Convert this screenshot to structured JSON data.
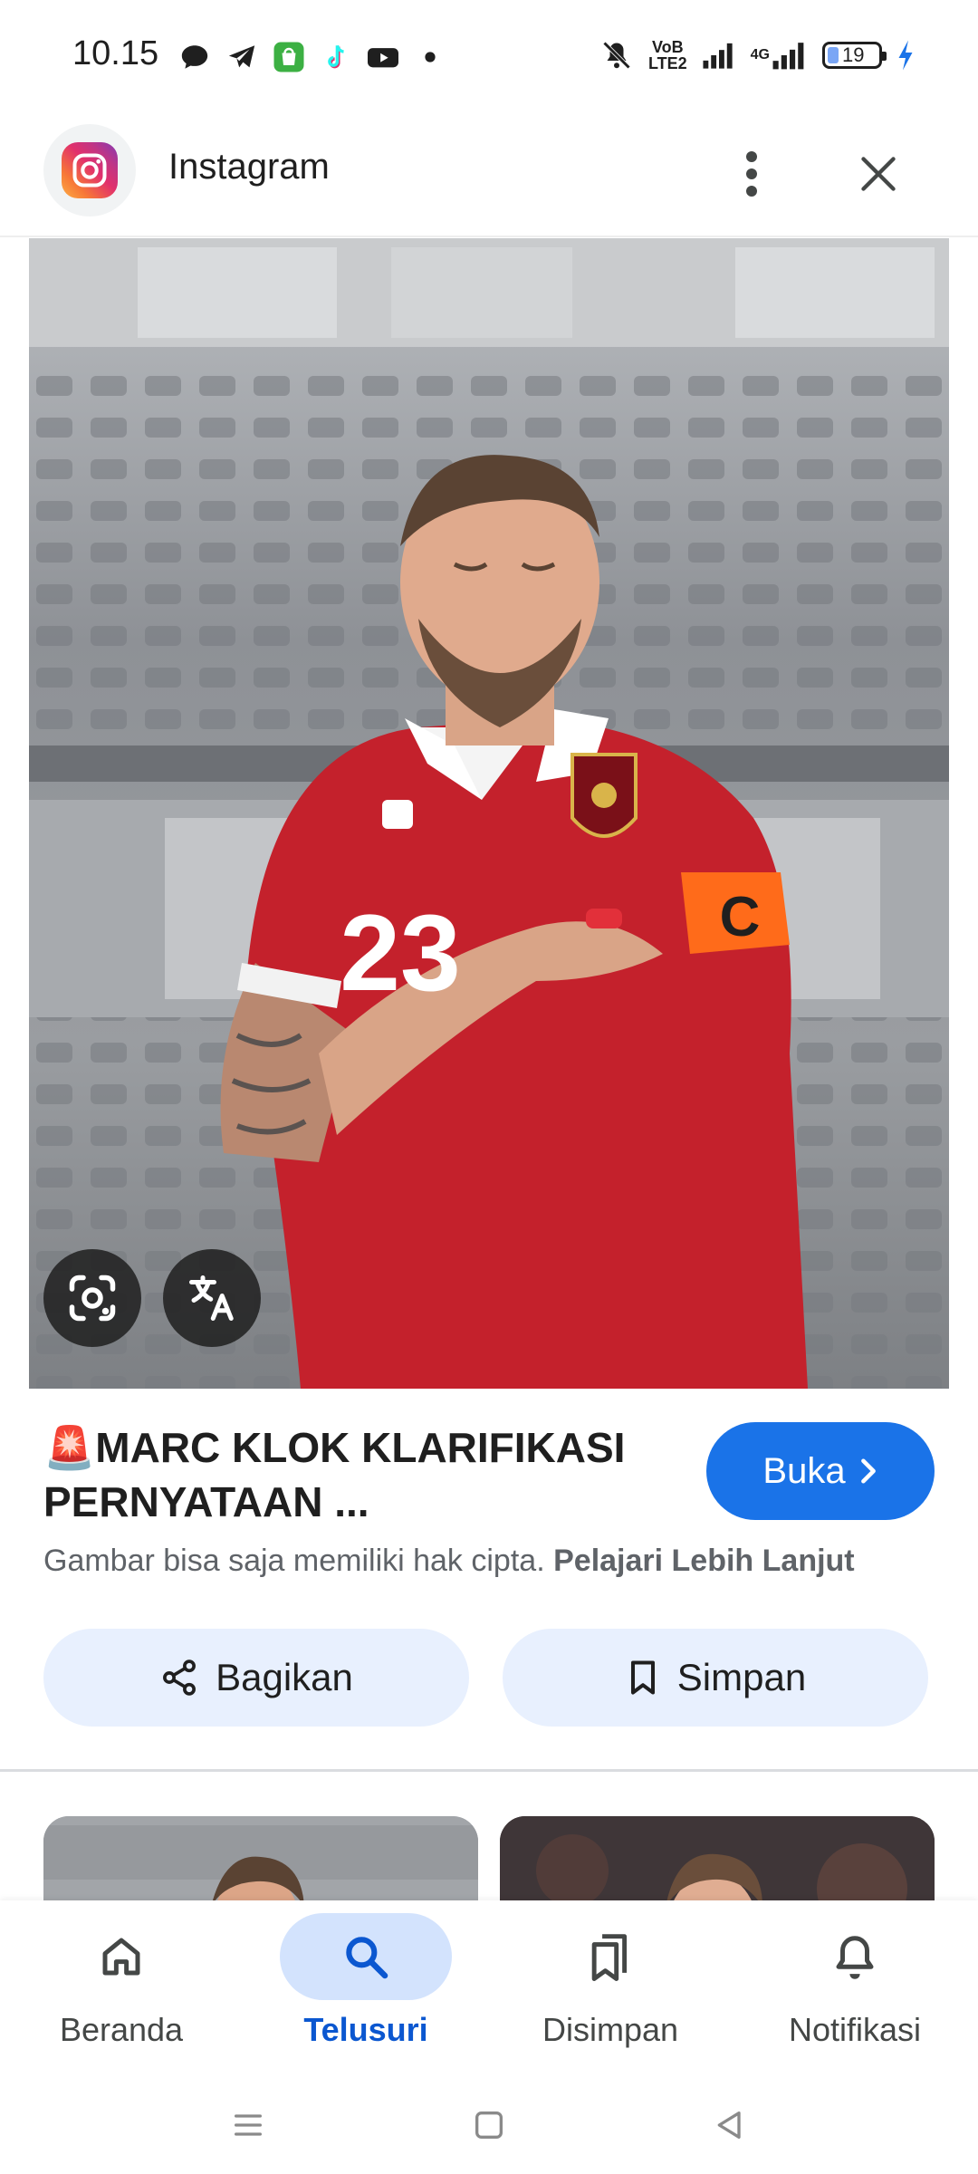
{
  "status_bar": {
    "time": "10.15",
    "volte_label_top": "VoB",
    "volte_label_bottom": "LTE2",
    "network_label": "4G",
    "battery_level": "19"
  },
  "header": {
    "app_name": "Instagram"
  },
  "result": {
    "title_emoji": "🚨",
    "title_text": "MARC KLOK KLARIFIKASI PERNYATAAN ...",
    "open_label": "Buka",
    "copyright_text": "Gambar bisa saja memiliki hak cipta.",
    "learn_more_label": "Pelajari Lebih Lanjut",
    "share_label": "Bagikan",
    "save_label": "Simpan"
  },
  "bottom_nav": {
    "items": [
      {
        "label": "Beranda",
        "icon": "home-icon",
        "active": false
      },
      {
        "label": "Telusuri",
        "icon": "search-icon",
        "active": true
      },
      {
        "label": "Disimpan",
        "icon": "collections-icon",
        "active": false
      },
      {
        "label": "Notifikasi",
        "icon": "bell-icon",
        "active": false
      }
    ]
  },
  "colors": {
    "accent": "#1a73e8",
    "active_nav": "#0b57d0",
    "chip_bg": "#e8f0fe",
    "active_pill": "#d3e3fd"
  }
}
